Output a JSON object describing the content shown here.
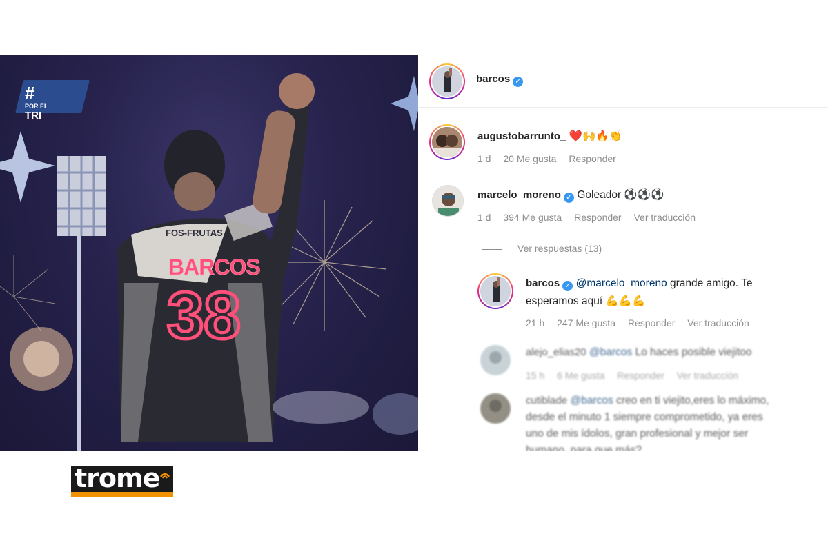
{
  "post": {
    "hashtag_symbol": "#",
    "hashtag_line1": "POR EL",
    "hashtag_line2": "TRI",
    "jersey_name": "BARCOS",
    "jersey_number": "38",
    "jersey_sponsor": "FOS-FRUTAS"
  },
  "header": {
    "username": "barcos",
    "verified": true
  },
  "comments": [
    {
      "username": "augustobarrunto_",
      "text": "❤️🙌🔥👏",
      "time": "1 d",
      "likes": "20 Me gusta",
      "reply": "Responder"
    },
    {
      "username": "marcelo_moreno",
      "verified": true,
      "text": "Goleador ⚽⚽⚽",
      "time": "1 d",
      "likes": "394 Me gusta",
      "reply": "Responder",
      "translate": "Ver traducción"
    }
  ],
  "view_replies": "Ver respuestas (13)",
  "replies": [
    {
      "username": "barcos",
      "verified": true,
      "mention": "@marcelo_moreno",
      "text_line1": " grande amigo. Te",
      "text_line2": "esperamos aquí 💪💪💪",
      "time": "21 h",
      "likes": "247 Me gusta",
      "reply": "Responder",
      "translate": "Ver traducción"
    },
    {
      "username": "alejo_elias20",
      "mention": "@barcos",
      "text": " Lo haces posible viejitoo",
      "time": "15 h",
      "likes": "6 Me gusta",
      "reply": "Responder",
      "translate": "Ver traducción"
    },
    {
      "username": "cutiblade",
      "mention": "@barcos",
      "text_line1": " creo en ti viejito,eres lo máximo,",
      "text_line2": "desde el minuto 1 siempre comprometido, ya eres",
      "text_line3": "uno de mis ídolos, gran profesional y mejor ser",
      "text_line4": "humano, para que más?"
    }
  ],
  "logo": {
    "text": "trome",
    "accent_color": "#f39200"
  },
  "colors": {
    "verified_blue": "#3897f0",
    "mention_blue": "#00376b",
    "meta_gray": "#8e8e8e"
  }
}
